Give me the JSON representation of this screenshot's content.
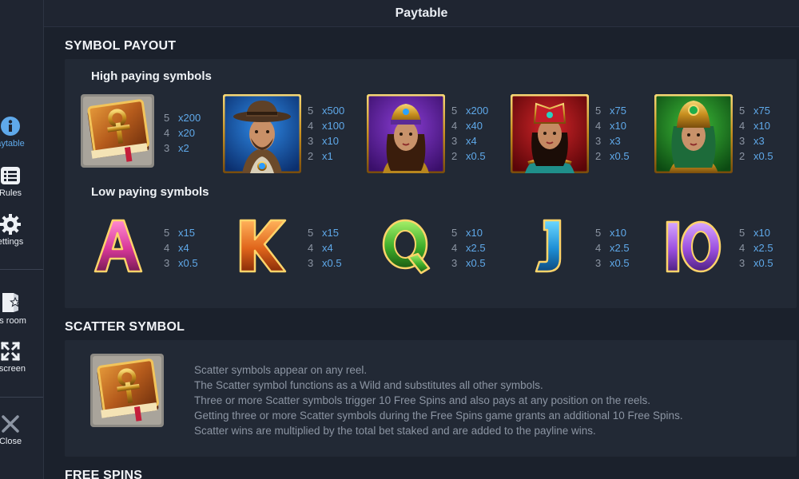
{
  "header": {
    "title": "Paytable"
  },
  "sidebar": {
    "items": [
      {
        "label": "aytable",
        "icon": "info-icon"
      },
      {
        "label": "Rules",
        "icon": "rules-icon"
      },
      {
        "label": "ettings",
        "icon": "settings-icon"
      },
      {
        "label": "us room",
        "icon": "bonus-room-icon"
      },
      {
        "label": "llscreen",
        "icon": "fullscreen-icon"
      },
      {
        "label": "Close",
        "icon": "close-icon"
      }
    ]
  },
  "colors": {
    "accent": "#5fa9ea",
    "muted": "#8c95a3",
    "panel": "#222935",
    "background": "#1b212c"
  },
  "symbol_payout": {
    "title": "SYMBOL PAYOUT",
    "high_title": "High paying symbols",
    "low_title": "Low paying symbols",
    "high": [
      {
        "symbol": "book",
        "pays": [
          [
            "5",
            "x200"
          ],
          [
            "4",
            "x20"
          ],
          [
            "3",
            "x2"
          ]
        ]
      },
      {
        "symbol": "explorer",
        "pays": [
          [
            "5",
            "x500"
          ],
          [
            "4",
            "x100"
          ],
          [
            "3",
            "x10"
          ],
          [
            "2",
            "x1"
          ]
        ]
      },
      {
        "symbol": "queen-purple",
        "pays": [
          [
            "5",
            "x200"
          ],
          [
            "4",
            "x40"
          ],
          [
            "3",
            "x4"
          ],
          [
            "2",
            "x0.5"
          ]
        ]
      },
      {
        "symbol": "queen-red",
        "pays": [
          [
            "5",
            "x75"
          ],
          [
            "4",
            "x10"
          ],
          [
            "3",
            "x3"
          ],
          [
            "2",
            "x0.5"
          ]
        ]
      },
      {
        "symbol": "queen-green",
        "pays": [
          [
            "5",
            "x75"
          ],
          [
            "4",
            "x10"
          ],
          [
            "3",
            "x3"
          ],
          [
            "2",
            "x0.5"
          ]
        ]
      }
    ],
    "low": [
      {
        "symbol": "A",
        "pays": [
          [
            "5",
            "x15"
          ],
          [
            "4",
            "x4"
          ],
          [
            "3",
            "x0.5"
          ]
        ]
      },
      {
        "symbol": "K",
        "pays": [
          [
            "5",
            "x15"
          ],
          [
            "4",
            "x4"
          ],
          [
            "3",
            "x0.5"
          ]
        ]
      },
      {
        "symbol": "Q",
        "pays": [
          [
            "5",
            "x10"
          ],
          [
            "4",
            "x2.5"
          ],
          [
            "3",
            "x0.5"
          ]
        ]
      },
      {
        "symbol": "J",
        "pays": [
          [
            "5",
            "x10"
          ],
          [
            "4",
            "x2.5"
          ],
          [
            "3",
            "x0.5"
          ]
        ]
      },
      {
        "symbol": "10",
        "pays": [
          [
            "5",
            "x10"
          ],
          [
            "4",
            "x2.5"
          ],
          [
            "3",
            "x0.5"
          ]
        ]
      }
    ]
  },
  "scatter": {
    "title": "SCATTER SYMBOL",
    "lines": [
      "Scatter symbols appear on any reel.",
      "The Scatter symbol functions as a Wild and substitutes all other symbols.",
      "Three or more Scatter symbols trigger 10 Free Spins and also pays at any position on the reels.",
      "Getting three or more Scatter symbols during the Free Spins game grants an additional 10 Free Spins.",
      "Scatter wins are multiplied by the total bet staked and are added to the payline wins."
    ]
  },
  "free_spins": {
    "title": "FREE SPINS"
  }
}
